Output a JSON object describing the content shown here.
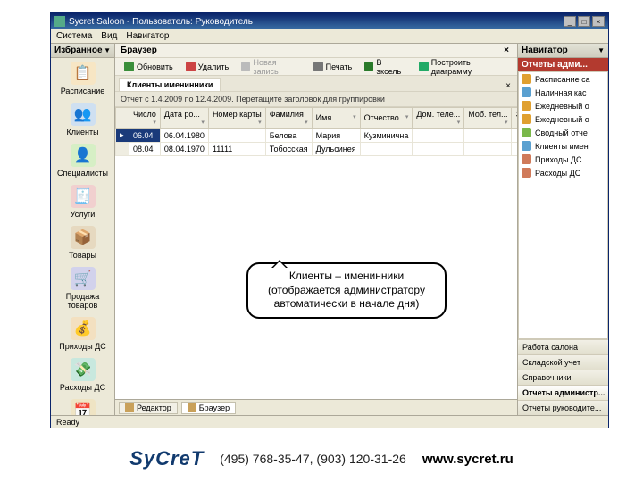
{
  "window": {
    "title": "Sycret Saloon - Пользователь: Руководитель",
    "min": "_",
    "max": "□",
    "close": "×"
  },
  "menu": {
    "items": [
      "Система",
      "Вид",
      "Навигатор"
    ]
  },
  "favorites": {
    "header": "Избранное",
    "items": [
      {
        "label": "Расписание",
        "g": "g1",
        "glyph": "📋"
      },
      {
        "label": "Клиенты",
        "g": "g2",
        "glyph": "👥"
      },
      {
        "label": "Специалисты",
        "g": "g3",
        "glyph": "👤"
      },
      {
        "label": "Услуги",
        "g": "g4",
        "glyph": "🧾"
      },
      {
        "label": "Товары",
        "g": "g5",
        "glyph": "📦"
      },
      {
        "label": "Продажа товаров",
        "g": "g6",
        "glyph": "🛒"
      },
      {
        "label": "Приходы ДС",
        "g": "g7",
        "glyph": "💰"
      },
      {
        "label": "Расходы ДС",
        "g": "g8",
        "glyph": "💸"
      },
      {
        "label": "Расписание",
        "g": "g9",
        "glyph": "📅"
      }
    ]
  },
  "browser": {
    "title": "Браузер",
    "toolbar": {
      "refresh": "Обновить",
      "delete": "Удалить",
      "add": "Новая запись",
      "print": "Печать",
      "excel": "В эксель",
      "chart": "Построить диаграмму"
    },
    "tab": "Клиенты именинники",
    "group_hint": "Отчет с 1.4.2009 по 12.4.2009. Перетащите заголовок для группировки",
    "columns": [
      "Число",
      "Дата ро...",
      "Номер карты",
      "Фамилия",
      "Имя",
      "Отчество",
      "Дом. теле...",
      "Моб. тел...",
      "Эл. ..."
    ],
    "rows": [
      {
        "sel": true,
        "cells": [
          "06.04",
          "06.04.1980",
          "",
          "Белова",
          "Мария",
          "Кузминична",
          "",
          "",
          ""
        ]
      },
      {
        "sel": false,
        "cells": [
          "08.04",
          "08.04.1970",
          "11111",
          "Тобосская",
          "Дульсинея",
          "",
          "",
          "",
          ""
        ]
      }
    ],
    "bottom": {
      "editor": "Редактор",
      "browser": "Браузер"
    }
  },
  "navigator": {
    "header": "Навигатор",
    "red_title": "Отчеты адми...",
    "tree": [
      {
        "t": "t1",
        "label": "Расписание са"
      },
      {
        "t": "t2",
        "label": "Наличная кас"
      },
      {
        "t": "t1",
        "label": "Ежедневный о"
      },
      {
        "t": "t1",
        "label": "Ежедневный о"
      },
      {
        "t": "t3",
        "label": "Сводный отче"
      },
      {
        "t": "t2",
        "label": "Клиенты имен"
      },
      {
        "t": "t4",
        "label": "Приходы ДС"
      },
      {
        "t": "t4",
        "label": "Расходы ДС"
      }
    ],
    "groups": [
      {
        "label": "Работа салона",
        "active": false
      },
      {
        "label": "Складской учет",
        "active": false
      },
      {
        "label": "Справочники",
        "active": false
      },
      {
        "label": "Отчеты администр...",
        "active": true
      },
      {
        "label": "Отчеты руководите...",
        "active": false
      }
    ]
  },
  "status": "Ready",
  "callout": {
    "line1": "Клиенты – именинники",
    "line2": "(отображается администратору",
    "line3": "автоматически в начале дня)"
  },
  "footer": {
    "logo": "SyCreT",
    "phones": "(495) 768-35-47, (903) 120-31-26",
    "site": "www.sycret.ru"
  }
}
